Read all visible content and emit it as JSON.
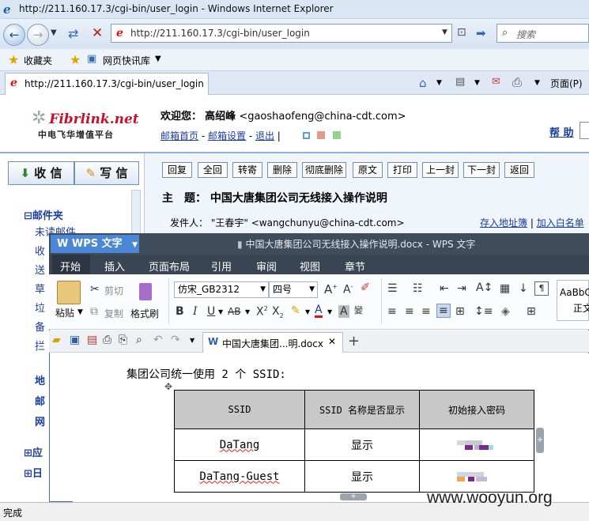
{
  "browser": {
    "window_title": "http://211.160.17.3/cgi-bin/user_login - Windows Internet Explorer",
    "address": "http://211.160.17.3/cgi-bin/user_login",
    "search_placeholder": "搜索",
    "favorites_label": "收藏夹",
    "web_slice_label": "网页快讯库",
    "tab_title": "http://211.160.17.3/cgi-bin/user_login",
    "page_menu": "页面(P)",
    "status": "完成"
  },
  "mail": {
    "brand": "Fibrlink.net",
    "brand_sub": "中电飞华增值平台",
    "welcome_label": "欢迎您：",
    "user_name": "高绍峰",
    "user_email": "<gaoshaofeng@china-cdt.com>",
    "links": [
      "邮箱首页",
      "邮箱设置",
      "退出"
    ],
    "help": "帮 助",
    "receive_btn": "收 信",
    "write_btn": "写 信",
    "folders_title": "邮件夹",
    "folders": [
      "未读邮件",
      "收",
      "送",
      "草",
      "垃",
      "备",
      "拦"
    ],
    "left_more": [
      "地",
      "邮",
      "网"
    ],
    "left_bottom": [
      "应",
      "日"
    ],
    "actions": [
      "回复",
      "全回",
      "转寄",
      "删除",
      "彻底删除",
      "原文",
      "打印",
      "上一封",
      "下一封",
      "返回"
    ],
    "subject_label": "主　题：",
    "subject": "中国大唐集团公司无线接入操作说明",
    "sender_label": "发件人：",
    "sender_name": "\"王春宇\"",
    "sender_email": "<wangchunyu@china-cdt.com>",
    "save_address": "存入地址簿",
    "add_whitelist": "加入白名单"
  },
  "wps": {
    "app_name": "WPS 文字",
    "doc_title": "中国大唐集团公司无线接入操作说明.docx - WPS 文字",
    "menu": [
      "开始",
      "插入",
      "页面布局",
      "引用",
      "审阅",
      "视图",
      "章节"
    ],
    "paste": "粘贴",
    "cut": "剪切",
    "copy": "复制",
    "format_painter": "格式刷",
    "font": "仿宋_GB2312",
    "size": "四号",
    "style_preview": "AaBbC",
    "style_name": "正文",
    "doc_tab": "中国大唐集团...明.docx",
    "intro": "集团公司统一使用 2 个 SSID:",
    "table_headers": [
      "SSID",
      "SSID 名称是否显示",
      "初始接入密码"
    ],
    "table_rows": [
      {
        "ssid": "DaTang",
        "visible": "显示"
      },
      {
        "ssid": "DaTang-Guest",
        "visible": "显示"
      }
    ]
  },
  "watermark": "www.wooyun.org"
}
